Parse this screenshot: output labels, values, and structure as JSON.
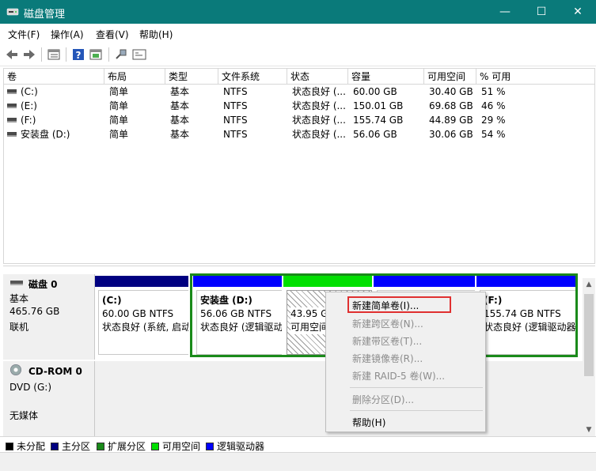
{
  "window": {
    "title": "磁盘管理",
    "min": "—",
    "max": "☐",
    "close": "✕"
  },
  "colors": {
    "titlebar": "#0a7a7a",
    "primary": "#0000ff",
    "unallocated": "#000000",
    "logical": "#0000ff",
    "free": "#00e000",
    "extended": "#1a8a1a",
    "navy": "#000080"
  },
  "menu": [
    "文件(F)",
    "操作(A)",
    "查看(V)",
    "帮助(H)"
  ],
  "toolbar": [
    "back-arrow-icon",
    "forward-arrow-icon",
    "list-view-icon",
    "help-icon",
    "properties-icon",
    "connect-icon",
    "console-icon"
  ],
  "volumes": {
    "headers": [
      "卷",
      "布局",
      "类型",
      "文件系统",
      "状态",
      "容量",
      "可用空间",
      "% 可用"
    ],
    "rows": [
      [
        "(C:)",
        "简单",
        "基本",
        "NTFS",
        "状态良好 (...",
        "60.00 GB",
        "30.40 GB",
        "51 %"
      ],
      [
        "(E:)",
        "简单",
        "基本",
        "NTFS",
        "状态良好 (...",
        "150.01 GB",
        "69.68 GB",
        "46 %"
      ],
      [
        "(F:)",
        "简单",
        "基本",
        "NTFS",
        "状态良好 (...",
        "155.74 GB",
        "44.89 GB",
        "29 %"
      ],
      [
        "安装盘 (D:)",
        "简单",
        "基本",
        "NTFS",
        "状态良好 (...",
        "56.06 GB",
        "30.06 GB",
        "54 %"
      ]
    ]
  },
  "disk0": {
    "name": "磁盘 0",
    "type": "基本",
    "size": "465.76 GB",
    "status": "联机",
    "partitions": [
      {
        "label": "(C:)",
        "size": "60.00 GB NTFS",
        "status": "状态良好 (系统, 启动"
      },
      {
        "label": "安装盘  (D:)",
        "size": "56.06 GB NTFS",
        "status": "状态良好 (逻辑驱动"
      },
      {
        "label": "",
        "size": "43.95 G",
        "status": "可用空间"
      },
      {
        "label": "",
        "size": "",
        "status": ""
      },
      {
        "label": "(F:)",
        "size": "155.74 GB NTFS",
        "status": "状态良好 (逻辑驱动器"
      }
    ]
  },
  "cdrom0": {
    "name": "CD-ROM 0",
    "drive": "DVD (G:)",
    "media": "无媒体"
  },
  "legend": [
    "未分配",
    "主分区",
    "扩展分区",
    "可用空间",
    "逻辑驱动器"
  ],
  "context_menu": {
    "items": [
      {
        "label": "新建简单卷(I)...",
        "enabled": true
      },
      {
        "label": "新建跨区卷(N)...",
        "enabled": false
      },
      {
        "label": "新建带区卷(T)...",
        "enabled": false
      },
      {
        "label": "新建镜像卷(R)...",
        "enabled": false
      },
      {
        "label": "新建 RAID-5 卷(W)...",
        "enabled": false
      },
      {
        "label": "删除分区(D)...",
        "enabled": false
      },
      {
        "label": "帮助(H)",
        "enabled": true
      }
    ]
  }
}
